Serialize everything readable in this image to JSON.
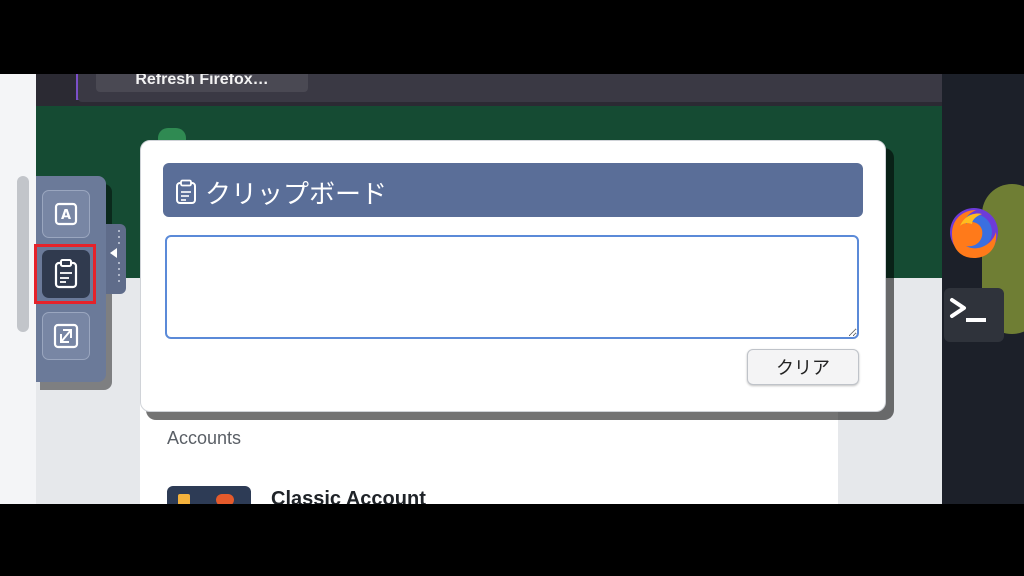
{
  "browser": {
    "refresh_button_label": "Refresh Firefox…"
  },
  "toolbar": {
    "items": [
      {
        "name": "keyboard",
        "icon": "letter-a-key-icon"
      },
      {
        "name": "clipboard",
        "icon": "clipboard-icon",
        "active": true
      },
      {
        "name": "fullscreen",
        "icon": "expand-icon"
      }
    ]
  },
  "clipboard_dialog": {
    "title": "クリップボード",
    "text_value": "",
    "clear_label": "クリア"
  },
  "page": {
    "accounts_heading": "Accounts",
    "account_name": "Classic Account"
  },
  "dock": {
    "apps": [
      "firefox-icon",
      "terminal-icon"
    ]
  },
  "colors": {
    "dialog_title_bg": "#5a6e98",
    "toolbar_bg": "#6b7a99",
    "highlight": "#e5222a",
    "header_green": "#154b33"
  }
}
